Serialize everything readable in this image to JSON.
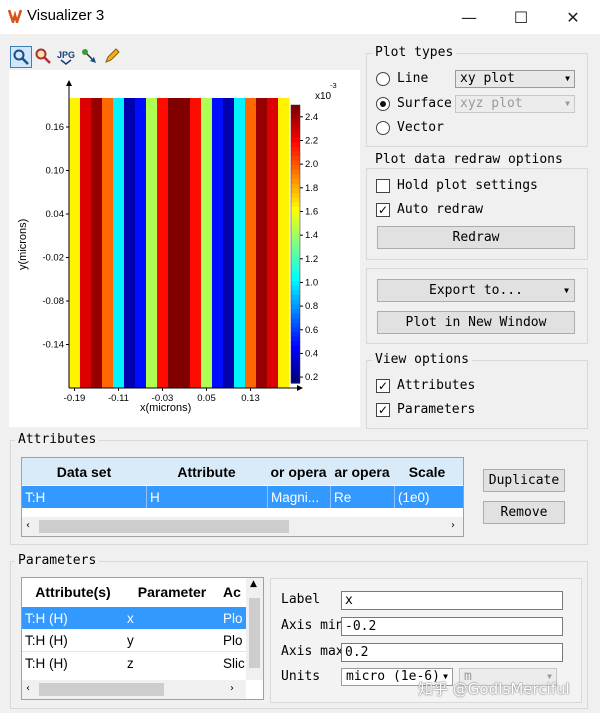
{
  "window": {
    "title": "Visualizer 3",
    "minimize_glyph": "—",
    "maximize_glyph": "☐",
    "close_glyph": "✕"
  },
  "toolbar": {
    "icons": [
      "zoom-icon",
      "zoom-region-icon",
      "jpg-export-icon",
      "data-cursor-icon",
      "pencil-icon"
    ],
    "jpg_label": "JPG"
  },
  "plot": {
    "exponent_label": "x10",
    "exponent_power": "-3",
    "xlabel": "x(microns)",
    "ylabel": "y(microns)",
    "x_ticks": [
      "-0.19",
      "-0.11",
      "-0.03",
      "0.05",
      "0.13"
    ],
    "y_ticks": [
      "0.16",
      "0.10",
      "0.04",
      "-0.02",
      "-0.08",
      "-0.14"
    ],
    "colorbar_ticks": [
      "2.4",
      "2.2",
      "2.0",
      "1.8",
      "1.6",
      "1.4",
      "1.2",
      "1.0",
      "0.8",
      "0.6",
      "0.4",
      "0.2"
    ]
  },
  "chart_data": {
    "type": "heatmap",
    "title": "",
    "xlabel": "x(microns)",
    "ylabel": "y(microns)",
    "xlim": [
      -0.2,
      0.2
    ],
    "ylim": [
      -0.2,
      0.2
    ],
    "colorbar_range": [
      0.2,
      2.4
    ],
    "colorbar_scale": "x10^-3",
    "colormap": "jet",
    "x": [
      -0.19,
      -0.17,
      -0.15,
      -0.13,
      -0.11,
      -0.09,
      -0.07,
      -0.05,
      -0.03,
      -0.01,
      0.01,
      0.03,
      0.05,
      0.07,
      0.09,
      0.11,
      0.13,
      0.15,
      0.17,
      0.19
    ],
    "values": [
      1.6,
      2.2,
      2.35,
      1.9,
      1.0,
      0.3,
      0.5,
      1.4,
      2.1,
      2.4,
      2.4,
      2.1,
      1.4,
      0.5,
      0.3,
      1.0,
      1.9,
      2.35,
      2.2,
      1.6
    ]
  },
  "plot_types": {
    "title": "Plot types",
    "options": [
      {
        "label": "Line",
        "selected": false,
        "combo": "xy plot",
        "combo_enabled": true
      },
      {
        "label": "Surface",
        "selected": true,
        "combo": "xyz plot",
        "combo_enabled": false
      },
      {
        "label": "Vector",
        "selected": false
      }
    ]
  },
  "redraw": {
    "title": "Plot data redraw options",
    "hold_label": "Hold plot settings",
    "hold_checked": false,
    "auto_label": "Auto redraw",
    "auto_checked": true,
    "redraw_button": "Redraw"
  },
  "export": {
    "export_label": "Export to...",
    "new_window_button": "Plot in New Window"
  },
  "view_options": {
    "title": "View options",
    "attributes_label": "Attributes",
    "attributes_checked": true,
    "parameters_label": "Parameters",
    "parameters_checked": true
  },
  "attributes": {
    "title": "Attributes",
    "columns": [
      "Data set",
      "Attribute",
      "or opera",
      "ar opera",
      "Scale"
    ],
    "rows": [
      [
        "T:H",
        "H",
        "Magni...",
        "Re",
        "(1e0)"
      ]
    ],
    "duplicate_button": "Duplicate",
    "remove_button": "Remove"
  },
  "parameters": {
    "title": "Parameters",
    "columns": [
      "Attribute(s)",
      "Parameter",
      "Ac"
    ],
    "rows": [
      [
        "T:H (H)",
        "x",
        "Plo"
      ],
      [
        "T:H (H)",
        "y",
        "Plo"
      ],
      [
        "T:H (H)",
        "z",
        "Slic"
      ]
    ],
    "label_label": "Label",
    "label_value": "x",
    "axis_min_label": "Axis min",
    "axis_min_value": "-0.2",
    "axis_max_label": "Axis max",
    "axis_max_value": "0.2",
    "units_label": "Units",
    "units_value": "micro (1e-6)",
    "units2_value": "m"
  },
  "watermark": "知乎 @GodIsMerciful",
  "colors": {
    "selection": "#3399ff",
    "table_header": "#d9ebf9"
  }
}
